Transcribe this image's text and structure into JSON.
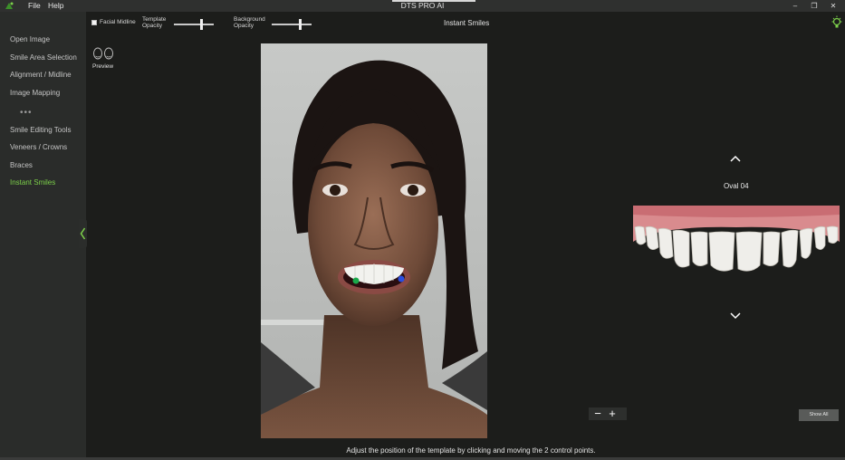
{
  "window": {
    "title": "DTS PRO AI",
    "minimize": "–",
    "maximize": "❐",
    "close": "✕"
  },
  "menu": {
    "file": "File",
    "help": "Help"
  },
  "sidebar": {
    "items": [
      {
        "label": "Open Image"
      },
      {
        "label": "Smile Area Selection"
      },
      {
        "label": "Alignment / Midline"
      },
      {
        "label": "Image Mapping"
      },
      {
        "label": "Smile Editing Tools"
      },
      {
        "label": "Veneers / Crowns"
      },
      {
        "label": "Braces"
      },
      {
        "label": "Instant Smiles"
      }
    ],
    "dots": "•••",
    "active_item": "Instant Smiles"
  },
  "toolbar": {
    "facial_midline_label": "Facial Midline",
    "facial_midline_checked": false,
    "template_opacity_line1": "Template",
    "template_opacity_line2": "Opacity",
    "template_opacity_value": 0.7,
    "background_opacity_line1": "Background",
    "background_opacity_line2": "Opacity",
    "background_opacity_value": 0.72
  },
  "panel_title": "Instant Smiles",
  "preview": {
    "label": "Preview"
  },
  "template_selector": {
    "name": "Oval 04"
  },
  "zoom": {
    "minus": "−",
    "plus": "+"
  },
  "show_all_label": "Show All",
  "status_message": "Adjust the position of the template by clicking and moving the 2 control points.",
  "colors": {
    "accent_green": "#7cd04a",
    "control_point_left": "#1aa84a",
    "control_point_right": "#2a4de0",
    "background": "#1c1d1b",
    "sidebar": "#2a2c2a"
  }
}
